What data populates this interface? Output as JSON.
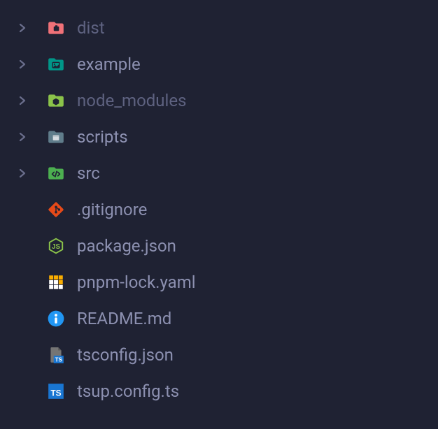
{
  "tree": {
    "items": [
      {
        "label": "dist",
        "type": "folder",
        "dimmed": true,
        "icon": "folder-dist"
      },
      {
        "label": "example",
        "type": "folder",
        "dimmed": false,
        "icon": "folder-example"
      },
      {
        "label": "node_modules",
        "type": "folder",
        "dimmed": true,
        "icon": "folder-node"
      },
      {
        "label": "scripts",
        "type": "folder",
        "dimmed": false,
        "icon": "folder-scripts"
      },
      {
        "label": "src",
        "type": "folder",
        "dimmed": false,
        "icon": "folder-src"
      },
      {
        "label": ".gitignore",
        "type": "file",
        "dimmed": false,
        "icon": "file-git"
      },
      {
        "label": "package.json",
        "type": "file",
        "dimmed": false,
        "icon": "file-nodejs"
      },
      {
        "label": "pnpm-lock.yaml",
        "type": "file",
        "dimmed": false,
        "icon": "file-pnpm"
      },
      {
        "label": "README.md",
        "type": "file",
        "dimmed": false,
        "icon": "file-info"
      },
      {
        "label": "tsconfig.json",
        "type": "file",
        "dimmed": false,
        "icon": "file-tsconfig"
      },
      {
        "label": "tsup.config.ts",
        "type": "file",
        "dimmed": false,
        "icon": "file-ts"
      }
    ]
  },
  "colors": {
    "bg": "#1f2233",
    "text": "#8488a8",
    "dim": "#5e6280"
  }
}
